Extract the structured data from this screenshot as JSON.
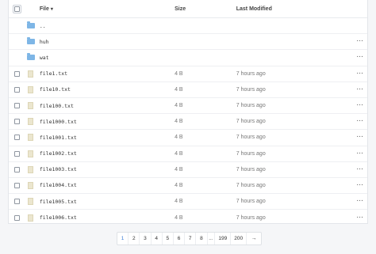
{
  "header": {
    "select_all": "",
    "name_label": "File",
    "sort_icon": "▾",
    "size_label": "Size",
    "modified_label": "Last Modified"
  },
  "folders": [
    {
      "name": ".."
    },
    {
      "name": "huh"
    },
    {
      "name": "wat"
    }
  ],
  "files": [
    {
      "name": "file1.txt",
      "size": "4 B",
      "modified": "7 hours ago"
    },
    {
      "name": "file10.txt",
      "size": "4 B",
      "modified": "7 hours ago"
    },
    {
      "name": "file100.txt",
      "size": "4 B",
      "modified": "7 hours ago"
    },
    {
      "name": "file1000.txt",
      "size": "4 B",
      "modified": "7 hours ago"
    },
    {
      "name": "file1001.txt",
      "size": "4 B",
      "modified": "7 hours ago"
    },
    {
      "name": "file1002.txt",
      "size": "4 B",
      "modified": "7 hours ago"
    },
    {
      "name": "file1003.txt",
      "size": "4 B",
      "modified": "7 hours ago"
    },
    {
      "name": "file1004.txt",
      "size": "4 B",
      "modified": "7 hours ago"
    },
    {
      "name": "file1005.txt",
      "size": "4 B",
      "modified": "7 hours ago"
    },
    {
      "name": "file1006.txt",
      "size": "4 B",
      "modified": "7 hours ago"
    }
  ],
  "more_label": "···",
  "pagination": {
    "pages": [
      "1",
      "2",
      "3",
      "4",
      "5",
      "6",
      "7",
      "8"
    ],
    "ellipsis": "...",
    "tail_pages": [
      "199",
      "200"
    ],
    "next": "→",
    "active": "1"
  },
  "colors": {
    "accent": "#3a7bd5",
    "folder": "#7eb6e6"
  }
}
